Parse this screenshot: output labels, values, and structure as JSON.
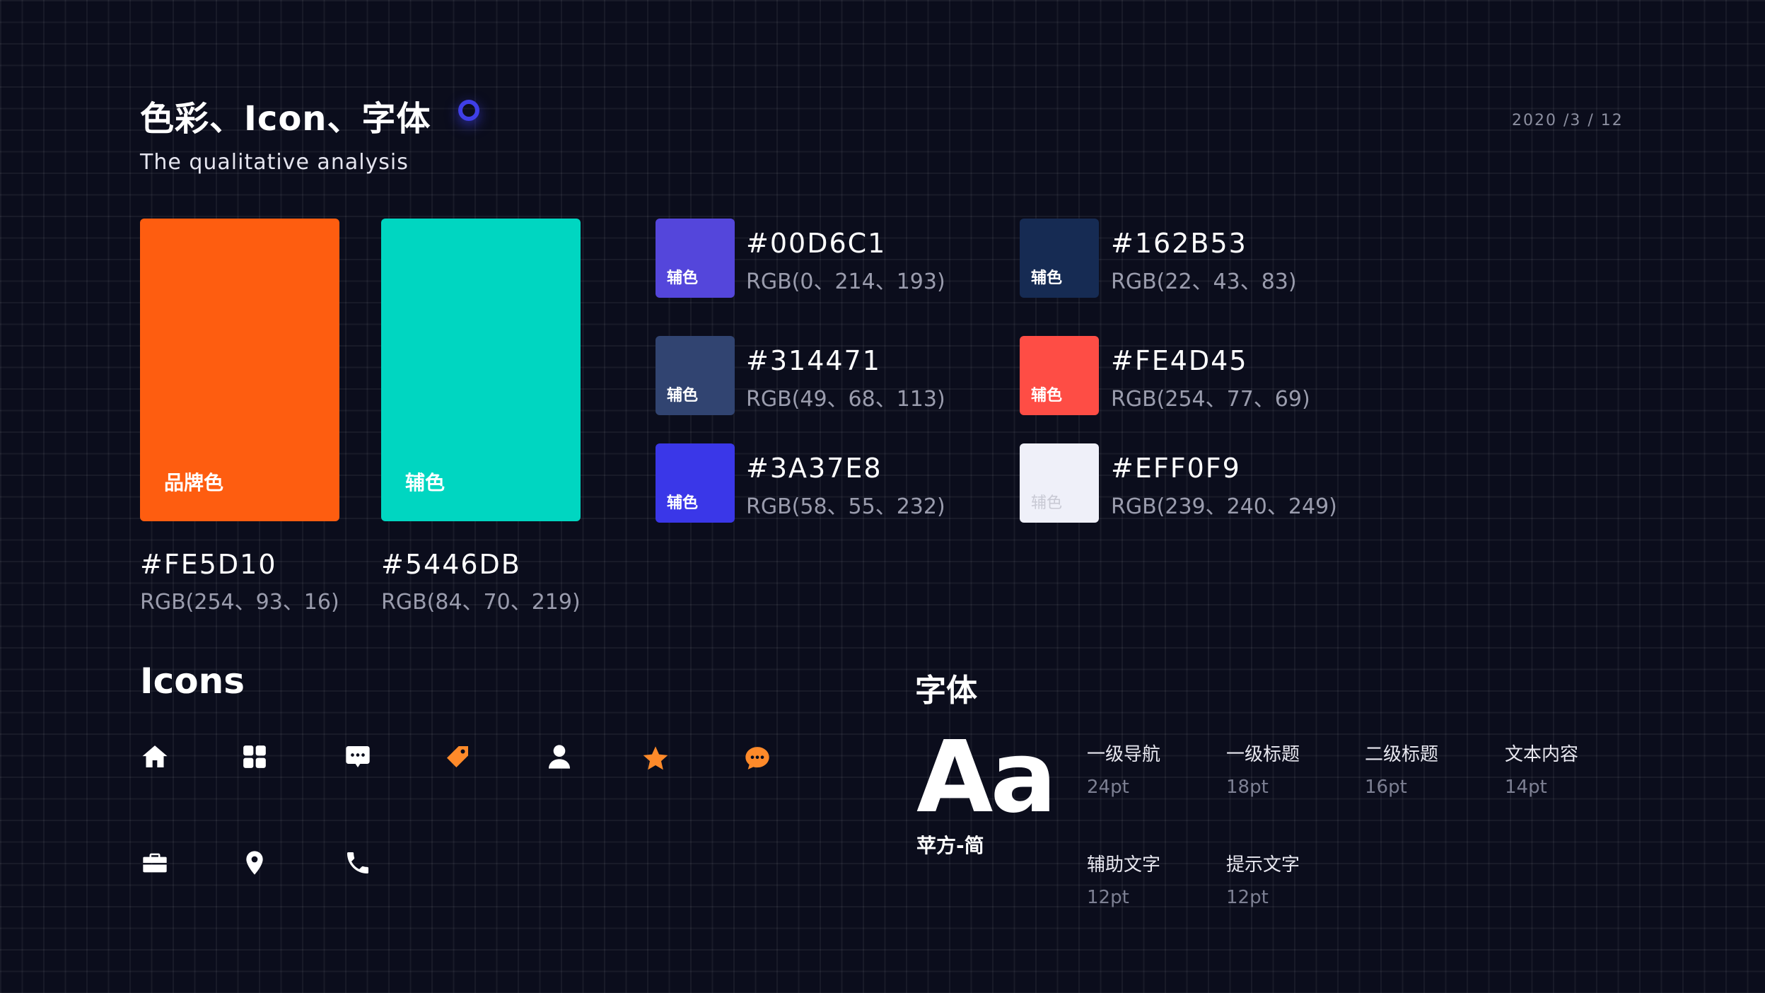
{
  "header": {
    "title": "色彩、Icon、字体",
    "subtitle": "The qualitative analysis",
    "date": "2020 /3 / 12"
  },
  "primary_colors": [
    {
      "label": "品牌色",
      "hex": "#FE5D10",
      "rgb": "RGB(254、93、16)",
      "swatch": "#fe5d10"
    },
    {
      "label": "辅色",
      "hex": "#5446DB",
      "rgb": "RGB(84、70、219)",
      "swatch": "#00d6c1"
    }
  ],
  "secondary_colors": [
    {
      "label": "辅色",
      "hex": "#00D6C1",
      "rgb": "RGB(0、214、193)",
      "swatch": "#5446db"
    },
    {
      "label": "辅色",
      "hex": "#162B53",
      "rgb": "RGB(22、43、83)",
      "swatch": "#162b53"
    },
    {
      "label": "辅色",
      "hex": "#314471",
      "rgb": "RGB(49、68、113)",
      "swatch": "#314471"
    },
    {
      "label": "辅色",
      "hex": "#FE4D45",
      "rgb": "RGB(254、77、69)",
      "swatch": "#fe4d45"
    },
    {
      "label": "辅色",
      "hex": "#3A37E8",
      "rgb": "RGB(58、55、232)",
      "swatch": "#3a37e8"
    },
    {
      "label": "辅色",
      "hex": "#EFF0F9",
      "rgb": "RGB(239、240、249)",
      "swatch": "#eff0f9"
    }
  ],
  "icons_section": {
    "title": "Icons",
    "icons": [
      {
        "name": "home-icon",
        "color": "#ffffff"
      },
      {
        "name": "grid-icon",
        "color": "#ffffff"
      },
      {
        "name": "message-icon",
        "color": "#ffffff"
      },
      {
        "name": "tag-icon",
        "color": "#fe8a2a"
      },
      {
        "name": "user-icon",
        "color": "#ffffff"
      },
      {
        "name": "star-icon",
        "color": "#fe8a2a"
      },
      {
        "name": "chat-icon",
        "color": "#fe8a2a"
      },
      {
        "name": "briefcase-icon",
        "color": "#ffffff"
      },
      {
        "name": "location-pin-icon",
        "color": "#ffffff"
      },
      {
        "name": "phone-icon",
        "color": "#ffffff"
      }
    ]
  },
  "font_section": {
    "title": "字体",
    "sample": "Aa",
    "font_name": "苹方-简",
    "specs": [
      {
        "label": "一级导航",
        "size": "24pt"
      },
      {
        "label": "一级标题",
        "size": "18pt"
      },
      {
        "label": "二级标题",
        "size": "16pt"
      },
      {
        "label": "文本内容",
        "size": "14pt"
      },
      {
        "label": "辅助文字",
        "size": "12pt"
      },
      {
        "label": "提示文字",
        "size": "12pt"
      }
    ]
  }
}
